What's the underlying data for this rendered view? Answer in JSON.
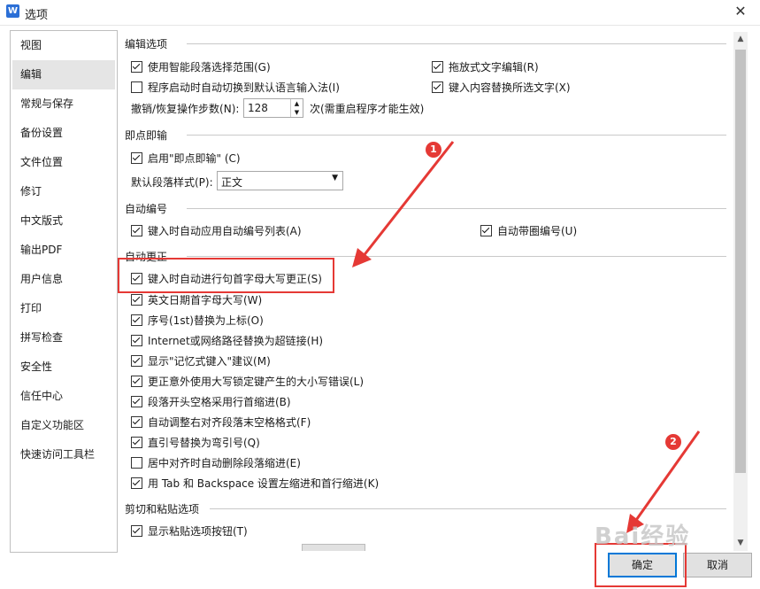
{
  "window": {
    "title": "选项",
    "app_icon_glyph": "W",
    "close_glyph": "✕"
  },
  "sidebar": {
    "items": [
      {
        "label": "视图"
      },
      {
        "label": "编辑"
      },
      {
        "label": "常规与保存"
      },
      {
        "label": "备份设置"
      },
      {
        "label": "文件位置"
      },
      {
        "label": "修订"
      },
      {
        "label": "中文版式"
      },
      {
        "label": "输出PDF"
      },
      {
        "label": "用户信息"
      },
      {
        "label": "打印"
      },
      {
        "label": "拼写检查"
      },
      {
        "label": "安全性"
      },
      {
        "label": "信任中心"
      },
      {
        "label": "自定义功能区"
      },
      {
        "label": "快速访问工具栏"
      }
    ],
    "active": "编辑"
  },
  "edit_options": {
    "title": "编辑选项",
    "smart_paragraph": {
      "label": "使用智能段落选择范围(G)",
      "checked": true
    },
    "drag_drop": {
      "label": "拖放式文字编辑(R)",
      "checked": true
    },
    "auto_ime": {
      "label": "程序启动时自动切换到默认语言输入法(I)",
      "checked": false
    },
    "replace_selection": {
      "label": "键入内容替换所选文字(X)",
      "checked": true
    },
    "undo_label": "撤销/恢复操作步数(N):",
    "undo_value": "128",
    "undo_suffix": "次(需重启程序才能生效)"
  },
  "click_type": {
    "title": "即点即输",
    "enable": {
      "label": "启用\"即点即输\" (C)",
      "checked": true
    },
    "style_label": "默认段落样式(P):",
    "style_value": "正文"
  },
  "auto_numbering": {
    "title": "自动编号",
    "apply_list": {
      "label": "键入时自动应用自动编号列表(A)",
      "checked": true
    },
    "circle_number": {
      "label": "自动带圈编号(U)",
      "checked": true
    }
  },
  "autocorrect": {
    "title": "自动更正",
    "items": [
      {
        "label": "键入时自动进行句首字母大写更正(S)",
        "checked": true
      },
      {
        "label": "英文日期首字母大写(W)",
        "checked": true
      },
      {
        "label": "序号(1st)替换为上标(O)",
        "checked": true
      },
      {
        "label": "Internet或网络路径替换为超链接(H)",
        "checked": true
      },
      {
        "label": "显示\"记忆式键入\"建议(M)",
        "checked": true
      },
      {
        "label": "更正意外使用大写锁定键产生的大小写错误(L)",
        "checked": true
      },
      {
        "label": "段落开头空格采用行首缩进(B)",
        "checked": true
      },
      {
        "label": "自动调整右对齐段落末空格格式(F)",
        "checked": true
      },
      {
        "label": "直引号替换为弯引号(Q)",
        "checked": true
      },
      {
        "label": "居中对齐时自动删除段落缩进(E)",
        "checked": false
      },
      {
        "label": "用 Tab 和 Backspace 设置左缩进和首行缩进(K)",
        "checked": true
      }
    ]
  },
  "paste_options": {
    "title": "剪切和粘贴选项",
    "show_button": {
      "label": "显示粘贴选项按钮(T)",
      "checked": true
    }
  },
  "buttons": {
    "ok": "确定",
    "cancel": "取消"
  },
  "annotations": {
    "badge1": "1",
    "badge2": "2",
    "watermark": "Bai经验"
  },
  "colors": {
    "annotation_red": "#e53935",
    "focus_blue": "#0078d7"
  }
}
